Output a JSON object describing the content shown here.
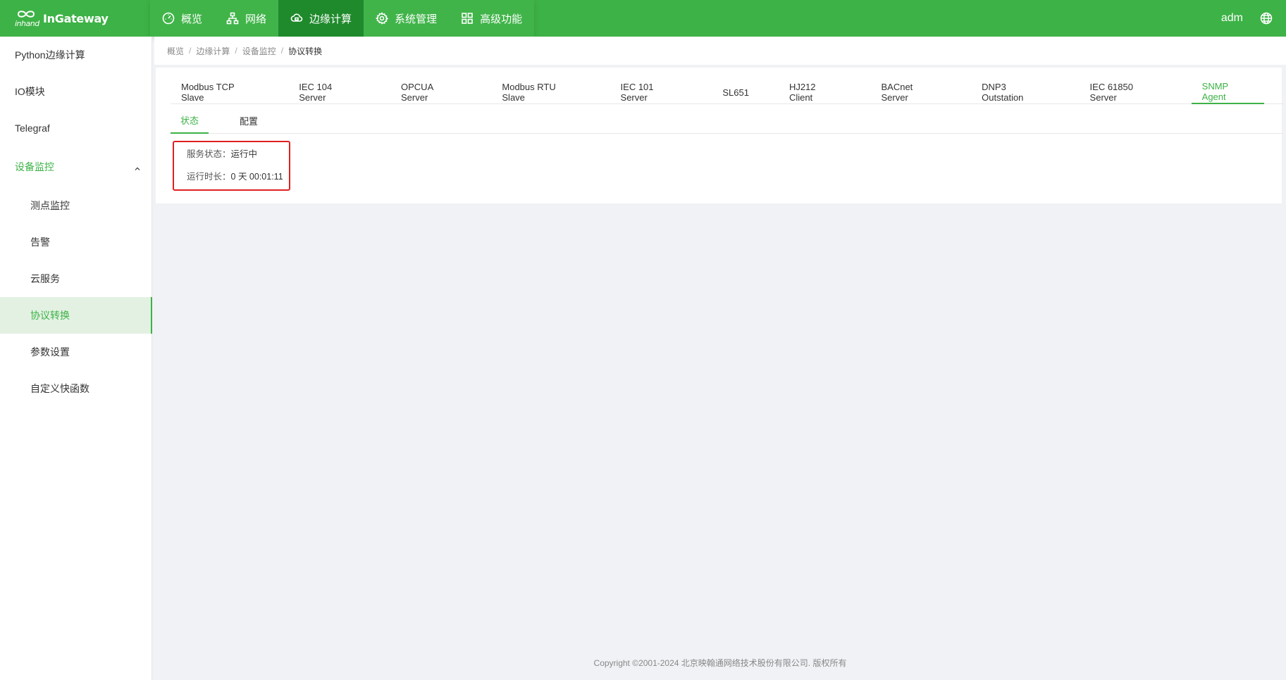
{
  "brand": {
    "logo_sub": "inhand",
    "name": "InGateway"
  },
  "nav": [
    {
      "label": "概览",
      "icon": "dashboard-icon"
    },
    {
      "label": "网络",
      "icon": "network-icon"
    },
    {
      "label": "边缘计算",
      "icon": "cloud-icon",
      "active": true
    },
    {
      "label": "系统管理",
      "icon": "gear-icon"
    },
    {
      "label": "高级功能",
      "icon": "grid-icon"
    }
  ],
  "user": {
    "name": "adm"
  },
  "sidebar": {
    "items": [
      {
        "label": "Python边缘计算"
      },
      {
        "label": "IO模块"
      },
      {
        "label": "Telegraf"
      },
      {
        "label": "设备监控",
        "open": true
      },
      {
        "label": "测点监控",
        "sub": true
      },
      {
        "label": "告警",
        "sub": true
      },
      {
        "label": "云服务",
        "sub": true
      },
      {
        "label": "协议转换",
        "sub": true,
        "selected": true
      },
      {
        "label": "参数设置",
        "sub": true
      },
      {
        "label": "自定义快函数",
        "sub": true
      }
    ]
  },
  "breadcrumb": [
    "概览",
    "边缘计算",
    "设备监控",
    "协议转换"
  ],
  "protocol_tabs": [
    "Modbus TCP Slave",
    "IEC 104 Server",
    "OPCUA Server",
    "Modbus RTU Slave",
    "IEC 101 Server",
    "SL651",
    "HJ212 Client",
    "BACnet Server",
    "DNP3 Outstation",
    "IEC 61850 Server",
    "SNMP Agent"
  ],
  "active_protocol": "SNMP Agent",
  "sub_tabs": [
    "状态",
    "配置"
  ],
  "status": {
    "service_label": "服务状态：",
    "service_value": "运行中",
    "uptime_label": "运行时长：",
    "uptime_value": "0 天 00:01:11"
  },
  "footer": "Copyright ©2001-2024 北京映翰通网络技术股份有限公司. 版权所有",
  "colors": {
    "primary": "#3db246",
    "nav_active": "#1f8a2c",
    "highlight": "#e02020"
  }
}
